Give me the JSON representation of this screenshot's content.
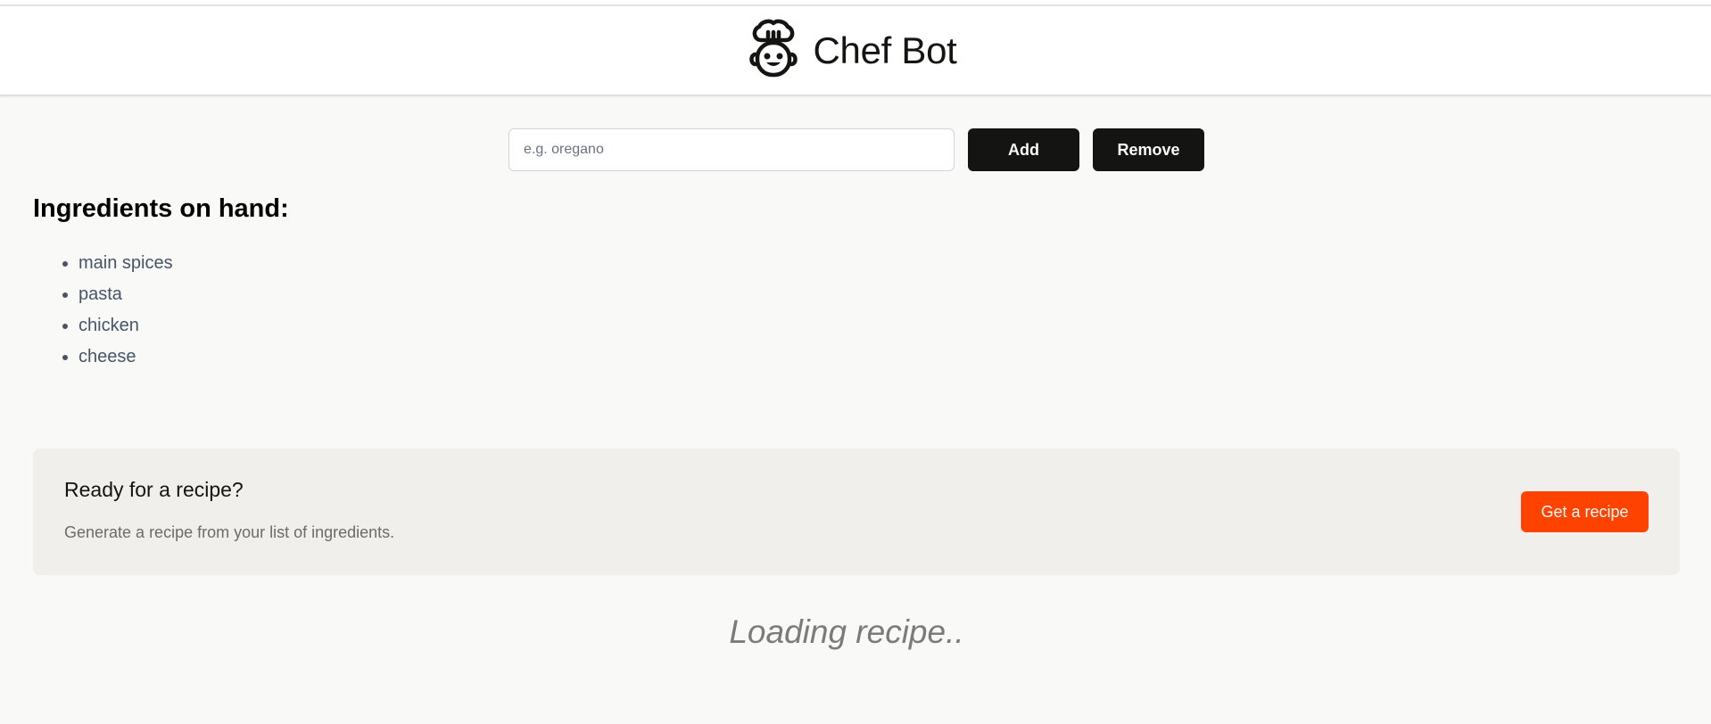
{
  "header": {
    "title": "Chef Bot",
    "logo_icon": "chef-robot-icon"
  },
  "form": {
    "placeholder": "e.g. oregano",
    "value": "",
    "add_label": "Add",
    "remove_label": "Remove"
  },
  "ingredients": {
    "heading": "Ingredients on hand:",
    "items": [
      "main spices",
      "pasta",
      "chicken",
      "cheese"
    ]
  },
  "recipe_card": {
    "title": "Ready for a recipe?",
    "description": "Generate a recipe from your list of ingredients.",
    "button_label": "Get a recipe"
  },
  "loading_text": "Loading recipe..",
  "colors": {
    "accent": "#fe4200",
    "dark_button": "#141413",
    "card_background": "#f0efeb",
    "page_background": "#f9f9f7"
  }
}
